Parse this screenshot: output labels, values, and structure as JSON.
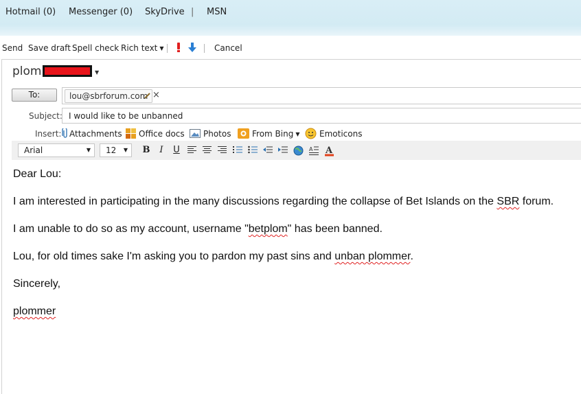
{
  "nav": {
    "hotmail": "Hotmail (0)",
    "messenger": "Messenger (0)",
    "skydrive": "SkyDrive",
    "divider": "|",
    "msn": "MSN"
  },
  "toolbar": {
    "send": "Send",
    "save_draft": "Save draft",
    "spell_check": "Spell check",
    "rich_text": "Rich text",
    "cancel": "Cancel"
  },
  "from": {
    "name_visible": "plom"
  },
  "to": {
    "button_label": "To:",
    "recipient": "lou@sbrforum.com"
  },
  "subject": {
    "label": "Subject:",
    "value": "I would like to be unbanned"
  },
  "insert": {
    "label": "Insert:",
    "attachments": "Attachments",
    "office_docs": "Office docs",
    "photos": "Photos",
    "from_bing": "From Bing",
    "emoticons": "Emoticons"
  },
  "format": {
    "font": "Arial",
    "size": "12"
  },
  "message": {
    "greeting": "Dear Lou:",
    "line1_pre": "I am interested in participating in the many discussions regarding the collapse of Bet Islands on the ",
    "line1_spell": "SBR",
    "line1_post": " forum.",
    "line2_pre": "I am unable to do so as my account, username \"",
    "line2_spell": "betplom",
    "line2_post": "\" has been banned.",
    "line3_pre": "Lou, for old times sake I'm asking you to pardon my past sins and ",
    "line3_spell": "unban plommer",
    "line3_post": ".",
    "closing": "Sincerely,",
    "signature": "plommer"
  },
  "colors": {
    "nav_bg": "#d3ebf4",
    "flag_red": "#e02020",
    "arrow_blue": "#2a7fd4",
    "redaction": "#e8141b"
  }
}
